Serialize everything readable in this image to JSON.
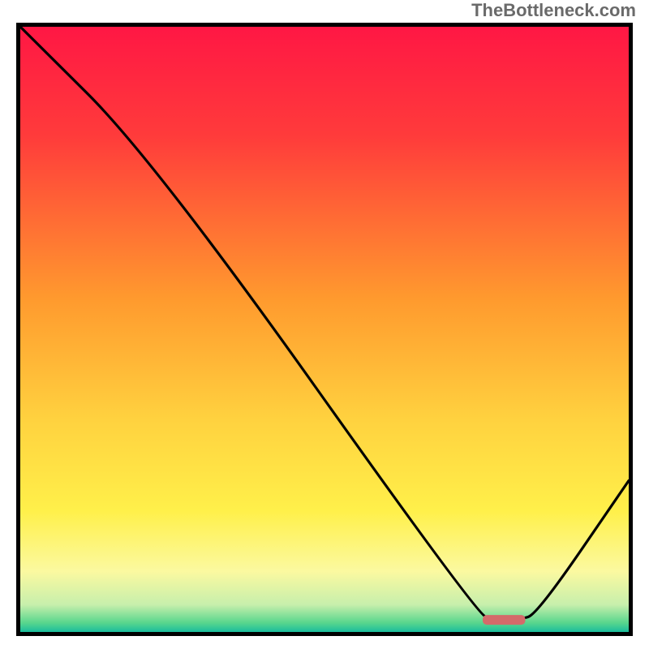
{
  "watermark": "TheBottleneck.com",
  "chart_data": {
    "type": "line",
    "title": "",
    "xlabel": "",
    "ylabel": "",
    "x_range": [
      0,
      100
    ],
    "y_range": [
      0,
      100
    ],
    "curve": [
      {
        "x": 0,
        "y": 100
      },
      {
        "x": 22,
        "y": 78
      },
      {
        "x": 75,
        "y": 3
      },
      {
        "x": 78,
        "y": 2
      },
      {
        "x": 82,
        "y": 2
      },
      {
        "x": 85,
        "y": 3
      },
      {
        "x": 100,
        "y": 25
      }
    ],
    "minimum_marker": {
      "x_start": 76,
      "x_end": 83,
      "y": 2,
      "color": "#d46a6a"
    },
    "gradient_stops": [
      {
        "offset": 0,
        "color": "#ff1744"
      },
      {
        "offset": 0.18,
        "color": "#ff3b3b"
      },
      {
        "offset": 0.45,
        "color": "#ff9a2e"
      },
      {
        "offset": 0.65,
        "color": "#ffd23f"
      },
      {
        "offset": 0.8,
        "color": "#fff04a"
      },
      {
        "offset": 0.9,
        "color": "#fbf9a0"
      },
      {
        "offset": 0.955,
        "color": "#c7efac"
      },
      {
        "offset": 0.985,
        "color": "#58d68d"
      },
      {
        "offset": 1.0,
        "color": "#1abc9c"
      }
    ]
  }
}
